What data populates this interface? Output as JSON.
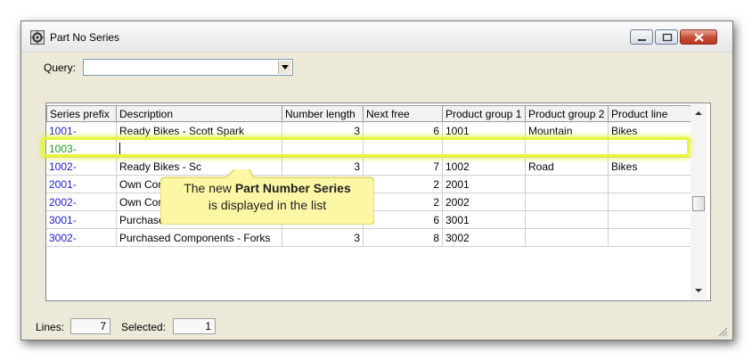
{
  "window": {
    "title": "Part No Series"
  },
  "query": {
    "label": "Query:",
    "value": ""
  },
  "grid": {
    "columns": [
      "Series prefix",
      "Description",
      "Number length",
      "Next free",
      "Product group 1",
      "Product group 2",
      "Product line"
    ],
    "rows": [
      [
        "1001-",
        "Ready Bikes - Scott Spark",
        "3",
        "6",
        "1001",
        "Mountain",
        "Bikes"
      ],
      [
        "1003-",
        "",
        "",
        "",
        "",
        "",
        ""
      ],
      [
        "1002-",
        "Ready Bikes - Sc",
        "3",
        "7",
        "1002",
        "Road",
        "Bikes"
      ],
      [
        "2001-",
        "Own Com",
        "",
        "2",
        "2001",
        "",
        ""
      ],
      [
        "2002-",
        "Own Com",
        "",
        "2",
        "2002",
        "",
        ""
      ],
      [
        "3001-",
        "Purchase",
        "",
        "6",
        "3001",
        "",
        ""
      ],
      [
        "3002-",
        "Purchased Components - Forks",
        "3",
        "8",
        "3002",
        "",
        ""
      ]
    ]
  },
  "callout": {
    "line1_prefix": "The new ",
    "line1_bold": "Part Number Series",
    "line2": "is displayed in the list"
  },
  "status": {
    "lines_label": "Lines:",
    "lines_value": "7",
    "selected_label": "Selected:",
    "selected_value": "1"
  },
  "colors": {
    "prefix_blue": "#1a1ad0",
    "new_row_green": "#1a9a1a",
    "highlight": "#e9f535",
    "callout_fill": "#fbf7a4"
  }
}
